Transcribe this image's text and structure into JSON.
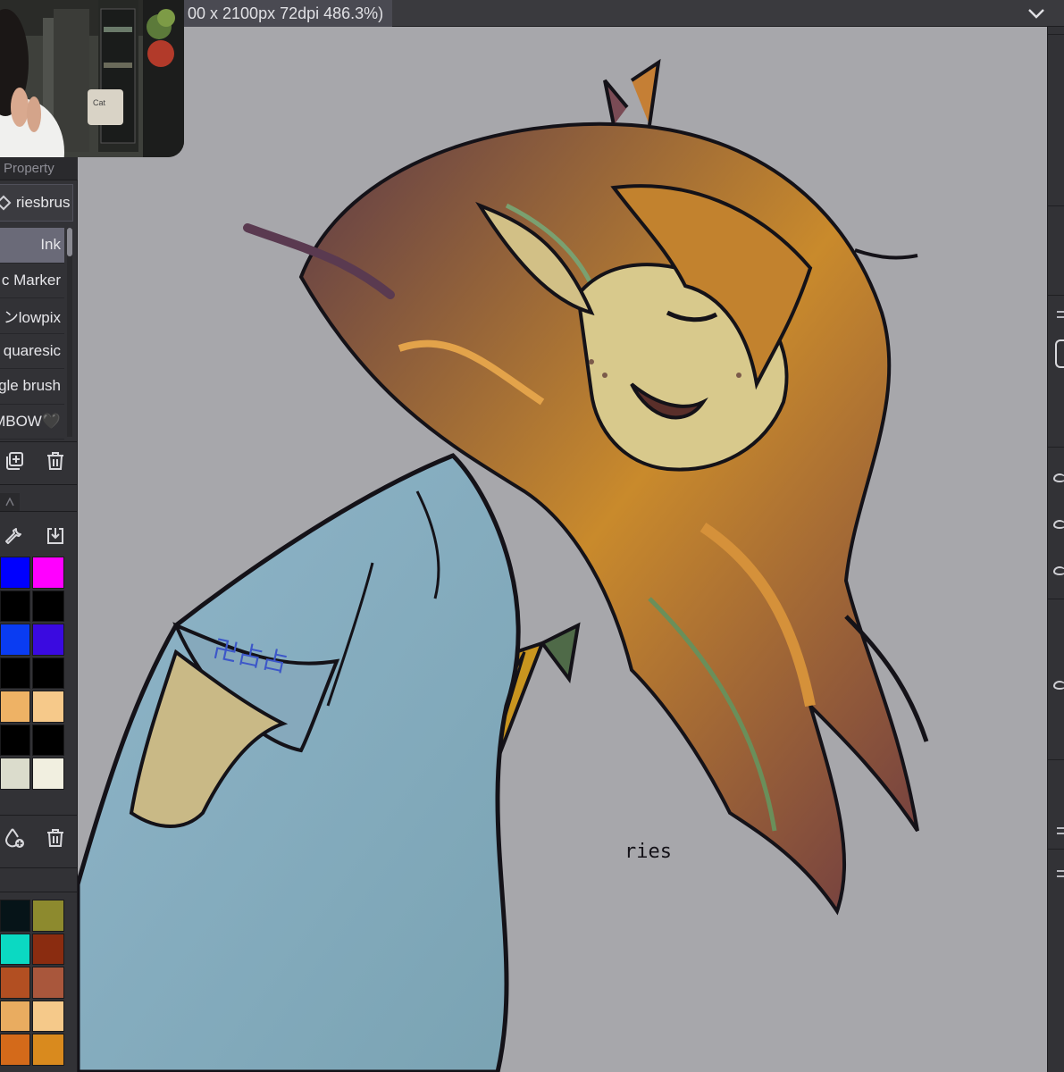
{
  "window": {
    "title": "00 x 2100px 72dpi 486.3%)"
  },
  "left_panel": {
    "tab_label": "Property",
    "current_brush": "riesbrus",
    "brushes": [
      {
        "label": "Ink",
        "selected": true
      },
      {
        "label": "c Marker",
        "selected": false
      },
      {
        "label": "ンlowpix",
        "selected": false
      },
      {
        "label": "quaresic",
        "selected": false
      },
      {
        "label": "gle brush",
        "selected": false
      },
      {
        "label": "MBOW🖤",
        "selected": false
      }
    ],
    "brush_actions": [
      "duplicate-icon",
      "trash-icon"
    ],
    "palette_actions": [
      "wrench-icon",
      "import-icon"
    ],
    "palette_colors": [
      [
        "#0000ff",
        "#ff00ff"
      ],
      [
        "#000000",
        "#000000"
      ],
      [
        "#0a3cf2",
        "#3a0ae0"
      ],
      [
        "#000000",
        "#000000"
      ],
      [
        "#eeb265",
        "#f6c98a"
      ],
      [
        "#000000",
        "#000000"
      ],
      [
        "#dbdccc",
        "#f1efe0"
      ]
    ],
    "palette2_actions": [
      "add-color-icon",
      "trash-icon"
    ],
    "palette2_colors": [
      [
        "#061418",
        "#8d8a2e"
      ],
      [
        "#0bd9c2",
        "#8a2c10"
      ],
      [
        "#b24f22",
        "#a9573c"
      ],
      [
        "#e9ac60",
        "#f5c98a"
      ],
      [
        "#d46a1a",
        "#d98a1e"
      ]
    ]
  },
  "canvas": {
    "background": "#a7a7ab",
    "signature": "ries"
  },
  "colors": {
    "panel": "#323236",
    "titlebar": "#3a3a3e",
    "selected": "#6a6a78"
  }
}
